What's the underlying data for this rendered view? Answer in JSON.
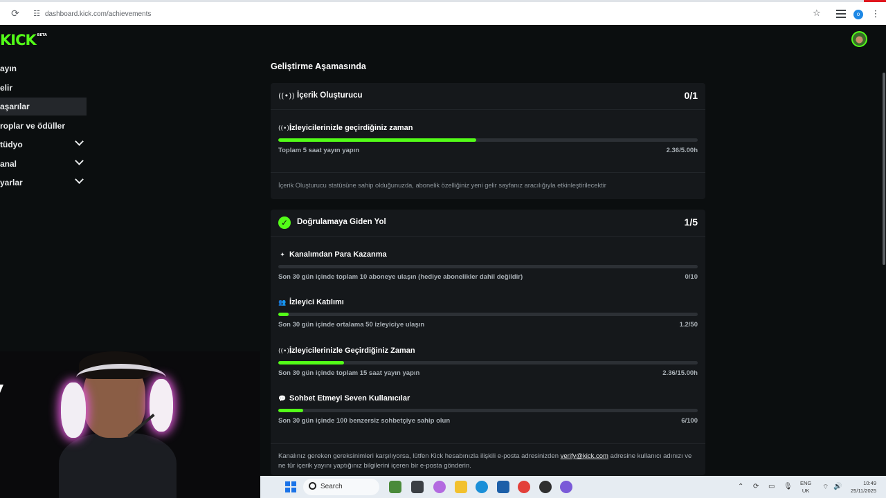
{
  "browser": {
    "url": "dashboard.kick.com/achievements"
  },
  "brand": {
    "logo_text": "KICK",
    "logo_badge": "BETA",
    "accent_color": "#53fc18"
  },
  "sidebar": {
    "items": [
      {
        "label": "ayın",
        "expandable": false,
        "active": false
      },
      {
        "label": "elir",
        "expandable": false,
        "active": false
      },
      {
        "label": "aşarılar",
        "expandable": false,
        "active": true
      },
      {
        "label": "roplar ve ödüller",
        "expandable": false,
        "active": false
      },
      {
        "label": "tüdyo",
        "expandable": true,
        "active": false
      },
      {
        "label": "anal",
        "expandable": true,
        "active": false
      },
      {
        "label": "yarlar",
        "expandable": true,
        "active": false
      }
    ]
  },
  "main": {
    "page_title": "Geliştirme Aşamasında",
    "cards": [
      {
        "icon": "broadcast-icon",
        "title": "İçerik Oluşturucu",
        "score": "0/1",
        "tasks": [
          {
            "icon": "broadcast-icon",
            "title": "İzleyicilerinizle geçirdiğiniz zaman",
            "progress_fraction": 0.472,
            "description": "Toplam 5 saat yayın yapın",
            "progress_text": "2.36/5.00h"
          }
        ],
        "info": "İçerik Oluşturucu statüsüne sahip olduğunuzda, abonelik özelliğiniz yeni gelir sayfanız aracılığıyla etkinleştirilecektir"
      },
      {
        "icon": "verified-badge-icon",
        "title": "Doğrulamaya Giden Yol",
        "score": "1/5",
        "tasks": [
          {
            "icon": "sparkle-icon",
            "title": "Kanalımdan Para Kazanma",
            "progress_fraction": 0,
            "description": "Son 30 gün içinde toplam 10 aboneye ulaşın (hediye abonelikler dahil değildir)",
            "progress_text": "0/10"
          },
          {
            "icon": "users-icon",
            "title": "İzleyici Katılımı",
            "progress_fraction": 0.024,
            "description": "Son 30 gün içinde ortalama 50 izleyiciye ulaşın",
            "progress_text": "1.2/50"
          },
          {
            "icon": "broadcast-icon",
            "title": "İzleyicilerinizle Geçirdiğiniz Zaman",
            "progress_fraction": 0.157,
            "description": "Son 30 gün içinde toplam 15 saat yayın yapın",
            "progress_text": "2.36/15.00h"
          },
          {
            "icon": "chat-bubble-icon",
            "title": "Sohbet Etmeyi Seven Kullanıcılar",
            "progress_fraction": 0.06,
            "description": "Son 30 gün içinde 100 benzersiz sohbetçiye sahip olun",
            "progress_text": "6/100"
          }
        ],
        "verify_text_before": "Kanalınız gereken gereksinimleri karşılıyorsa, lütfen Kick hesabınızla ilişkili e-posta adresinizden ",
        "verify_link": "verify@kick.com",
        "verify_text_after": " adresine kullanıcı adınızı ve ne tür içerik yayını yaptığınız bilgilerini içeren bir e-posta gönderin."
      }
    ]
  },
  "taskbar": {
    "search_label": "Search",
    "language_line1": "ENG",
    "language_line2": "UK",
    "time": "10:49",
    "date": "25/11/2025"
  }
}
